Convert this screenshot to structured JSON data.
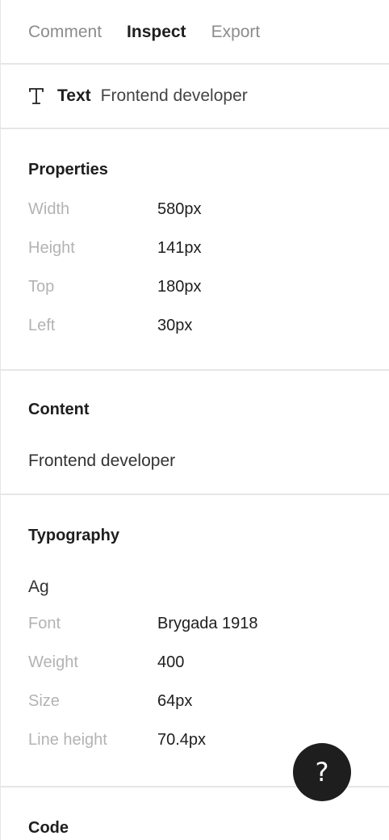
{
  "tabs": [
    {
      "label": "Comment",
      "active": false
    },
    {
      "label": "Inspect",
      "active": true
    },
    {
      "label": "Export",
      "active": false
    }
  ],
  "layer": {
    "icon": "text-type-icon",
    "type": "Text",
    "name": "Frontend developer"
  },
  "properties": {
    "title": "Properties",
    "rows": [
      {
        "label": "Width",
        "value": "580px"
      },
      {
        "label": "Height",
        "value": "141px"
      },
      {
        "label": "Top",
        "value": "180px"
      },
      {
        "label": "Left",
        "value": "30px"
      }
    ]
  },
  "content": {
    "title": "Content",
    "text": "Frontend developer"
  },
  "typography": {
    "title": "Typography",
    "sample": "Ag",
    "rows": [
      {
        "label": "Font",
        "value": "Brygada 1918"
      },
      {
        "label": "Weight",
        "value": "400"
      },
      {
        "label": "Size",
        "value": "64px"
      },
      {
        "label": "Line height",
        "value": "70.4px"
      }
    ]
  },
  "code": {
    "title": "Code"
  },
  "help": {
    "label": "?",
    "icon": "question-icon"
  },
  "colors": {
    "text_primary": "#1e1e1e",
    "text_muted": "#b3b3b3",
    "tab_inactive": "#8c8c8c",
    "divider": "#e6e6e6",
    "help_bg": "#1e1e1e"
  }
}
